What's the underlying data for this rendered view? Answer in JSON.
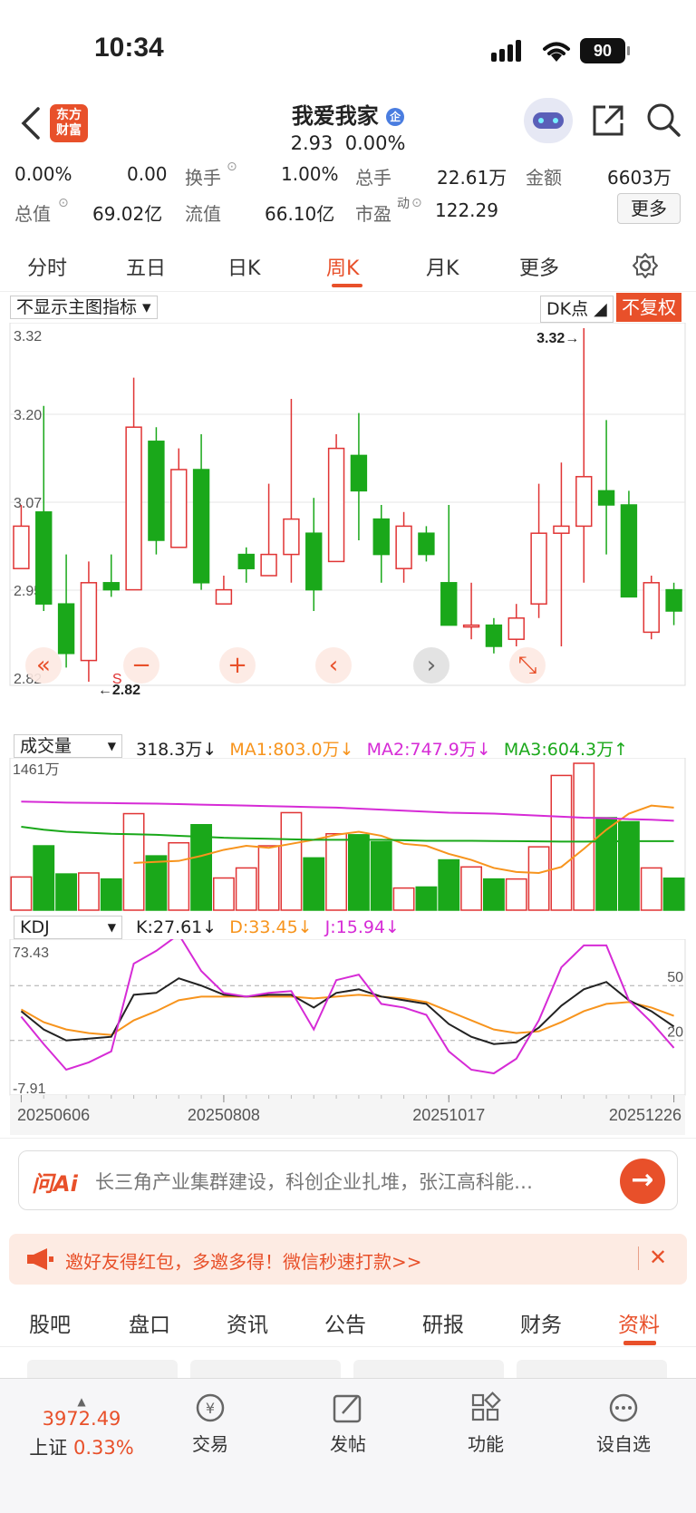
{
  "status": {
    "time": "10:34",
    "battery": "90"
  },
  "header": {
    "logo_text": "东方\n财富",
    "title": "我爱我家",
    "badge": "企",
    "price": "2.93",
    "change": "0.00%"
  },
  "quote": {
    "row1": {
      "pct": "0.00%",
      "chg": "0.00",
      "turnover_label": "换手",
      "turnover": "1.00%",
      "volume_label": "总手",
      "volume": "22.61万",
      "amount_label": "金额",
      "amount": "6603万"
    },
    "row2": {
      "mktcap_label": "总值",
      "mktcap": "69.02亿",
      "float_label": "流值",
      "float": "66.10亿",
      "pe_label": "市盈",
      "pe_sup": "动",
      "pe": "122.29",
      "more": "更多"
    }
  },
  "tabs": [
    "分时",
    "五日",
    "日K",
    "周K",
    "月K",
    "更多"
  ],
  "chart_controls": {
    "indicator": "不显示主图指标",
    "dk": "DK点",
    "adjust": "不复权"
  },
  "chart_data": [
    {
      "type": "candlestick",
      "title": "周K",
      "ylim": [
        2.82,
        3.32
      ],
      "y_ticks": [
        "3.32",
        "3.20",
        "3.07",
        "2.95",
        "2.82"
      ],
      "x_ticks": [
        "20250606",
        "20250808",
        "20251017",
        "20251226"
      ],
      "max_label": "3.32→",
      "min_label": "2.82",
      "s_marker": "S",
      "candles": [
        {
          "o": 2.98,
          "c": 3.04,
          "h": 3.07,
          "l": 3.0,
          "up": true
        },
        {
          "o": 3.06,
          "c": 2.93,
          "h": 3.21,
          "l": 2.92,
          "up": false
        },
        {
          "o": 2.93,
          "c": 2.86,
          "h": 3.0,
          "l": 2.84,
          "up": false
        },
        {
          "o": 2.85,
          "c": 2.96,
          "h": 2.99,
          "l": 2.82,
          "up": true
        },
        {
          "o": 2.96,
          "c": 2.95,
          "h": 3.0,
          "l": 2.94,
          "up": false
        },
        {
          "o": 2.95,
          "c": 3.18,
          "h": 3.25,
          "l": 2.95,
          "up": true
        },
        {
          "o": 3.16,
          "c": 3.02,
          "h": 3.18,
          "l": 3.0,
          "up": false
        },
        {
          "o": 3.01,
          "c": 3.12,
          "h": 3.15,
          "l": 3.01,
          "up": true
        },
        {
          "o": 3.12,
          "c": 2.96,
          "h": 3.17,
          "l": 2.95,
          "up": false
        },
        {
          "o": 2.95,
          "c": 2.93,
          "h": 2.97,
          "l": 2.93,
          "up": true
        },
        {
          "o": 3.0,
          "c": 2.98,
          "h": 3.01,
          "l": 2.96,
          "up": false
        },
        {
          "o": 2.97,
          "c": 3.0,
          "h": 3.1,
          "l": 2.97,
          "up": true
        },
        {
          "o": 3.0,
          "c": 3.05,
          "h": 3.22,
          "l": 2.96,
          "up": true
        },
        {
          "o": 3.03,
          "c": 2.95,
          "h": 3.08,
          "l": 2.92,
          "up": false
        },
        {
          "o": 2.99,
          "c": 3.15,
          "h": 3.17,
          "l": 2.99,
          "up": true
        },
        {
          "o": 3.14,
          "c": 3.09,
          "h": 3.2,
          "l": 3.02,
          "up": false
        },
        {
          "o": 3.05,
          "c": 3.0,
          "h": 3.07,
          "l": 2.96,
          "up": false
        },
        {
          "o": 2.98,
          "c": 3.04,
          "h": 3.06,
          "l": 2.96,
          "up": true
        },
        {
          "o": 3.03,
          "c": 3.0,
          "h": 3.04,
          "l": 2.99,
          "up": false
        },
        {
          "o": 2.96,
          "c": 2.9,
          "h": 3.07,
          "l": 2.9,
          "up": false
        },
        {
          "o": 2.9,
          "c": 2.9,
          "h": 2.96,
          "l": 2.88,
          "up": true
        },
        {
          "o": 2.9,
          "c": 2.87,
          "h": 2.91,
          "l": 2.86,
          "up": false
        },
        {
          "o": 2.88,
          "c": 2.91,
          "h": 2.93,
          "l": 2.87,
          "up": true
        },
        {
          "o": 2.93,
          "c": 3.03,
          "h": 3.1,
          "l": 2.91,
          "up": true
        },
        {
          "o": 3.03,
          "c": 3.04,
          "h": 3.13,
          "l": 2.87,
          "up": true
        },
        {
          "o": 3.04,
          "c": 3.11,
          "h": 3.32,
          "l": 2.96,
          "up": true
        },
        {
          "o": 3.09,
          "c": 3.07,
          "h": 3.19,
          "l": 3.0,
          "up": false
        },
        {
          "o": 3.07,
          "c": 2.94,
          "h": 3.09,
          "l": 2.94,
          "up": false
        },
        {
          "o": 2.96,
          "c": 2.89,
          "h": 2.97,
          "l": 2.88,
          "up": true
        },
        {
          "o": 2.95,
          "c": 2.92,
          "h": 2.96,
          "l": 2.9,
          "up": false
        }
      ]
    },
    {
      "type": "bar",
      "title": "成交量",
      "ylim": [
        0,
        1461
      ],
      "y_max_label": "1461万",
      "legend": {
        "vol": "318.3万↓",
        "ma1": "MA1:803.0万↓",
        "ma2": "MA2:747.9万↓",
        "ma3": "MA3:604.3万↑"
      },
      "colors": {
        "ma1": "#f7941d",
        "ma2": "#d62bd6",
        "ma3": "#1aa81a"
      },
      "values": [
        {
          "v": 330,
          "up": true
        },
        {
          "v": 640,
          "up": false
        },
        {
          "v": 360,
          "up": false
        },
        {
          "v": 370,
          "up": true
        },
        {
          "v": 310,
          "up": false
        },
        {
          "v": 960,
          "up": true
        },
        {
          "v": 540,
          "up": false
        },
        {
          "v": 670,
          "up": true
        },
        {
          "v": 850,
          "up": false
        },
        {
          "v": 320,
          "up": true
        },
        {
          "v": 420,
          "up": true
        },
        {
          "v": 640,
          "up": true
        },
        {
          "v": 970,
          "up": true
        },
        {
          "v": 520,
          "up": false
        },
        {
          "v": 760,
          "up": true
        },
        {
          "v": 750,
          "up": false
        },
        {
          "v": 680,
          "up": false
        },
        {
          "v": 220,
          "up": true
        },
        {
          "v": 230,
          "up": false
        },
        {
          "v": 500,
          "up": false
        },
        {
          "v": 430,
          "up": true
        },
        {
          "v": 310,
          "up": false
        },
        {
          "v": 310,
          "up": true
        },
        {
          "v": 630,
          "up": true
        },
        {
          "v": 1340,
          "up": true
        },
        {
          "v": 1461,
          "up": true
        },
        {
          "v": 920,
          "up": false
        },
        {
          "v": 880,
          "up": false
        },
        {
          "v": 420,
          "up": true
        },
        {
          "v": 318,
          "up": false
        }
      ],
      "ma1": [
        null,
        null,
        null,
        null,
        null,
        470,
        480,
        490,
        540,
        600,
        640,
        620,
        660,
        700,
        750,
        780,
        740,
        660,
        640,
        560,
        500,
        420,
        380,
        370,
        430,
        610,
        800,
        960,
        1040,
        1020
      ],
      "ma2": [
        1080,
        1075,
        1070,
        1068,
        1065,
        1062,
        1060,
        1055,
        1050,
        1045,
        1040,
        1035,
        1030,
        1025,
        1020,
        1010,
        1000,
        990,
        980,
        970,
        965,
        960,
        950,
        940,
        930,
        920,
        915,
        905,
        900,
        890
      ],
      "ma3": [
        830,
        800,
        780,
        770,
        760,
        755,
        750,
        740,
        730,
        720,
        715,
        710,
        705,
        700,
        700,
        700,
        700,
        695,
        690,
        690,
        690,
        688,
        686,
        684,
        682,
        682,
        684,
        686,
        686,
        686
      ]
    },
    {
      "type": "line",
      "title": "KDJ",
      "ylim": [
        -7.91,
        73.43
      ],
      "y_max_label": "73.43",
      "y_min_label": "-7.91",
      "ref_lines": [
        "50",
        "20"
      ],
      "legend": {
        "k": "K:27.61↓",
        "d": "D:33.45↓",
        "j": "J:15.94↓"
      },
      "colors": {
        "k": "#222222",
        "d": "#f7941d",
        "j": "#d62bd6"
      },
      "series": {
        "k": [
          36,
          26,
          20,
          21,
          22,
          45,
          46,
          54,
          50,
          45,
          44,
          45,
          45,
          38,
          46,
          48,
          44,
          42,
          40,
          29,
          22,
          18,
          19,
          27,
          39,
          48,
          52,
          42,
          36,
          27.61
        ],
        "d": [
          37,
          30,
          26,
          24,
          23,
          31,
          36,
          42,
          44,
          44,
          44,
          44,
          44,
          43,
          44,
          45,
          44,
          43,
          41,
          36,
          31,
          26,
          24,
          25,
          30,
          36,
          40,
          41,
          38,
          33.45
        ],
        "j": [
          33,
          18,
          4,
          8,
          14,
          62,
          69,
          78,
          58,
          46,
          44,
          46,
          47,
          26,
          53,
          56,
          40,
          38,
          34,
          14,
          4,
          2,
          10,
          31,
          60,
          72,
          72,
          42,
          30,
          15.94
        ]
      }
    }
  ],
  "kdj_label": "KDJ",
  "vol_label": "成交量",
  "ai": {
    "logo": "问Ai",
    "text": "长三角产业集群建设，科创企业扎堆，张江高科能…"
  },
  "promo": {
    "text": "邀好友得红包，多邀多得！微信秒速打款>>"
  },
  "bottom_tabs": [
    "股吧",
    "盘口",
    "资讯",
    "公告",
    "研报",
    "财务",
    "资料"
  ],
  "bottom_bar": {
    "index_value": "3972.49",
    "index_name": "上证",
    "index_change": "0.33%",
    "trade": "交易",
    "post": "发帖",
    "func": "功能",
    "watch": "设自选"
  }
}
